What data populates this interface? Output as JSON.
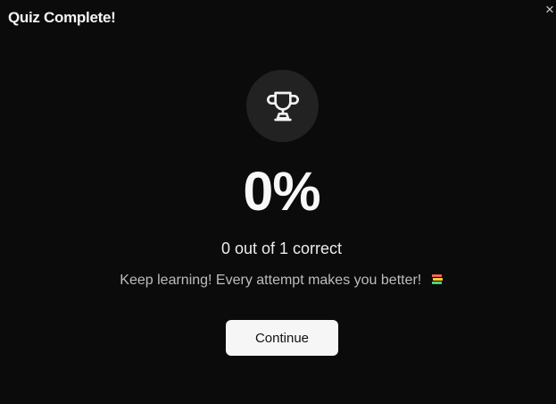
{
  "dialog": {
    "title": "Quiz Complete!",
    "close_label": "×"
  },
  "result": {
    "score": "0%",
    "summary": "0 out of 1 correct",
    "message": "Keep learning! Every attempt makes you better!",
    "message_icon": "books-icon"
  },
  "actions": {
    "continue_label": "Continue"
  },
  "icons": {
    "hero": "trophy-icon"
  },
  "colors": {
    "background": "#0b0b0b",
    "circle": "#222222",
    "button_bg": "#f6f6f6",
    "button_text": "#111111"
  }
}
